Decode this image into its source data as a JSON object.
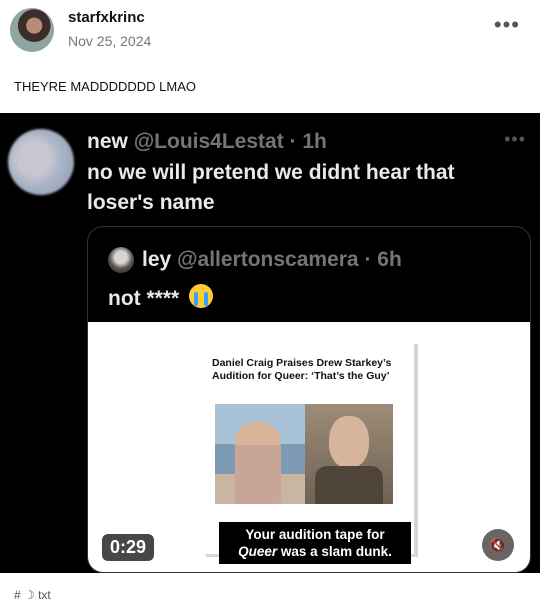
{
  "post": {
    "username": "starfxkrinc",
    "date": "Nov 25, 2024",
    "more_icon": "more-horizontal-icon",
    "caption": "THEYRE MADDDDDDD LMAO"
  },
  "tweet": {
    "display_name": "new",
    "handle_time": "@Louis4Lestat · 1h",
    "text": "no we will pretend we didnt hear that loser's name",
    "quote": {
      "display_name": "ley",
      "handle_time": "@allertonscamera · 6h",
      "text": "not ****",
      "emoji": "loudly-crying-face-emoji",
      "video": {
        "headline": "Daniel Craig Praises Drew Starkey’s Audition for Queer: ‘That’s the Guy’",
        "subtitle_line1": "Your audition tape for",
        "subtitle_em": "Queer",
        "subtitle_line2_rest": " was a slam dunk.",
        "duration": "0:29",
        "mute_icon": "volume-muted-icon"
      }
    }
  },
  "footer": {
    "tags": "# ☽ txt"
  }
}
